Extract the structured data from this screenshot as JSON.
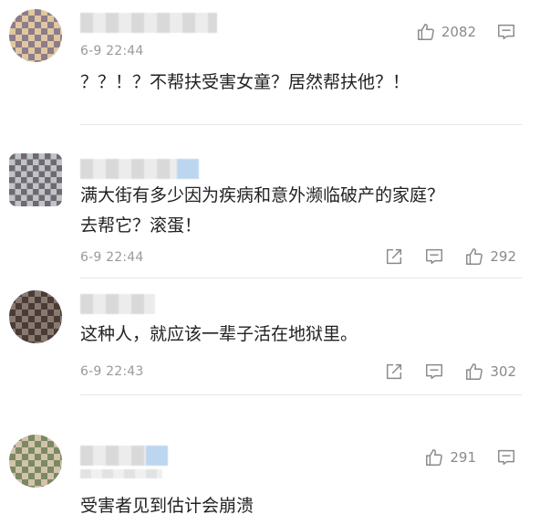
{
  "comments": [
    {
      "time": "6-9 22:44",
      "text": "？？！？不帮扶受害女童？居然帮扶他？！",
      "likes": "2082",
      "icons": [
        "thumbs-up-icon",
        "comment-icon"
      ]
    },
    {
      "time": "6-9 22:44",
      "text": "满大街有多少因为疾病和意外濒临破产的家庭？\n去帮它？滚蛋！",
      "likes": "292",
      "icons": [
        "share-icon",
        "comment-icon",
        "thumbs-up-icon"
      ]
    },
    {
      "time": "6-9 22:43",
      "text": "这种人，就应该一辈子活在地狱里。",
      "likes": "302",
      "icons": [
        "share-icon",
        "comment-icon",
        "thumbs-up-icon"
      ]
    },
    {
      "time": "",
      "text": "受害者见到估计会崩溃",
      "likes": "291",
      "icons": [
        "thumbs-up-icon",
        "comment-icon"
      ]
    }
  ]
}
